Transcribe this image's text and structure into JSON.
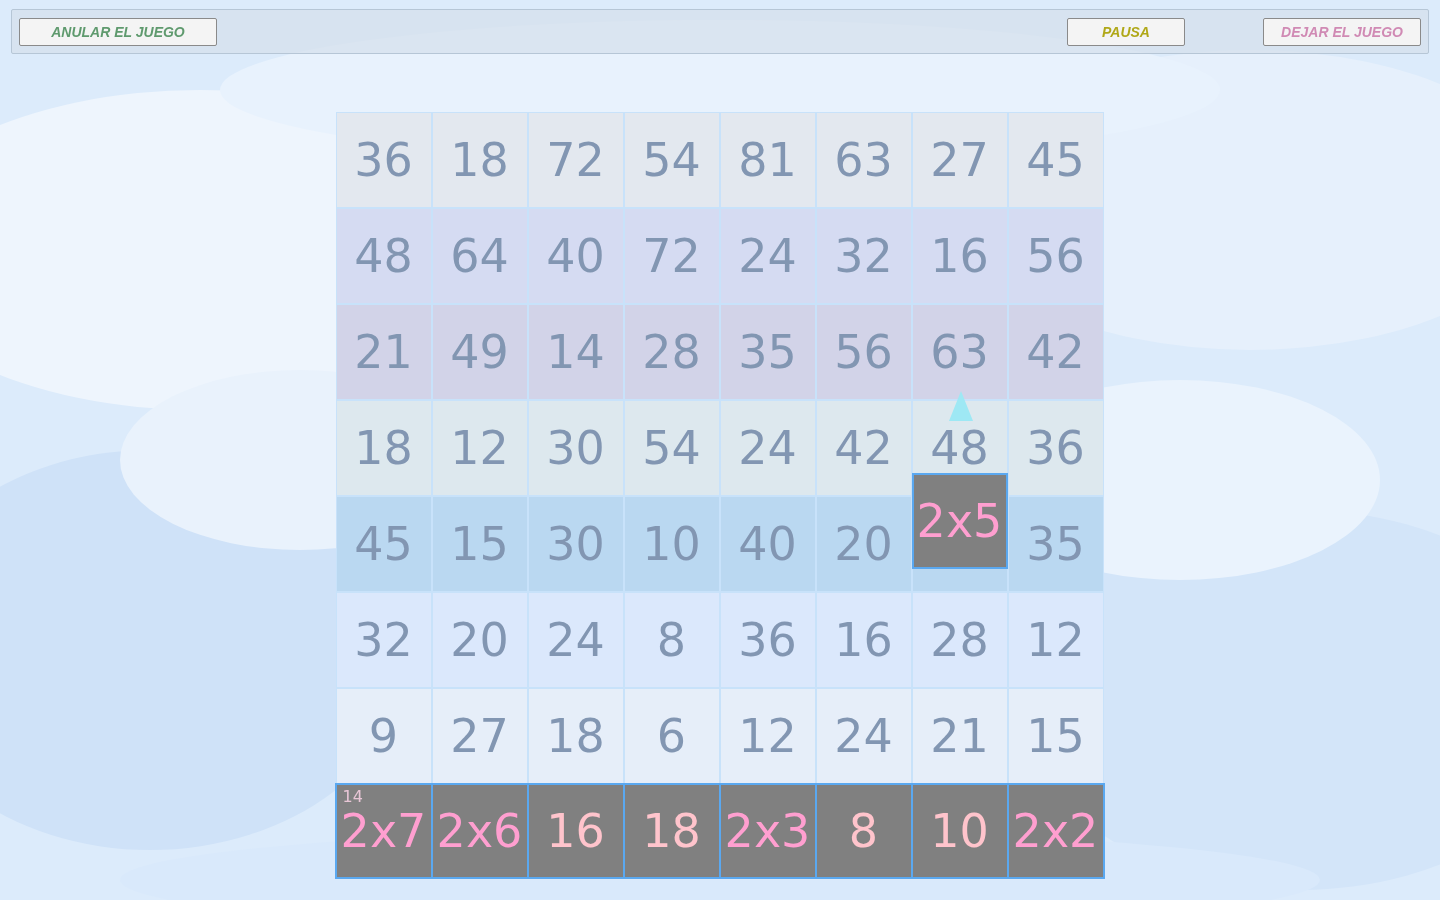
{
  "toolbar": {
    "buttons": [
      {
        "label": "ANULAR EL JUEGO",
        "color": "#5f9a6e"
      },
      {
        "label": "PAUSA",
        "color": "#b0a818"
      },
      {
        "label": "DEJAR EL JUEGO",
        "color": "#d08ab4"
      }
    ]
  },
  "board": {
    "rows": [
      {
        "color": "#e3e8ef",
        "cells": [
          "36",
          "18",
          "72",
          "54",
          "81",
          "63",
          "27",
          "45"
        ]
      },
      {
        "color": "#d5dbf2",
        "cells": [
          "48",
          "64",
          "40",
          "72",
          "24",
          "32",
          "16",
          "56"
        ]
      },
      {
        "color": "#d2d3e8",
        "cells": [
          "21",
          "49",
          "14",
          "28",
          "35",
          "56",
          "63",
          "42"
        ]
      },
      {
        "color": "#dde8ee",
        "cells": [
          "18",
          "12",
          "30",
          "54",
          "24",
          "42",
          "48",
          "36"
        ],
        "falling": {
          "label": "2x5"
        }
      },
      {
        "color": "#bad8f1",
        "cells": [
          "45",
          "15",
          "30",
          "10",
          "40",
          "20",
          null,
          "35"
        ]
      },
      {
        "color": "#dbe8fc",
        "cells": [
          "32",
          "20",
          "24",
          "8",
          "36",
          "16",
          "28",
          "12"
        ]
      },
      {
        "color": "#e6eef9",
        "cells": [
          "9",
          "27",
          "18",
          "6",
          "12",
          "24",
          "21",
          "15"
        ]
      }
    ],
    "tray": [
      {
        "label": "2x7",
        "kind": "product",
        "ghost": "14"
      },
      {
        "label": "2x6",
        "kind": "product"
      },
      {
        "label": "16",
        "kind": "result"
      },
      {
        "label": "18",
        "kind": "result"
      },
      {
        "label": "2x3",
        "kind": "product"
      },
      {
        "label": "8",
        "kind": "result"
      },
      {
        "label": "10",
        "kind": "result"
      },
      {
        "label": "2x2",
        "kind": "product"
      }
    ]
  }
}
